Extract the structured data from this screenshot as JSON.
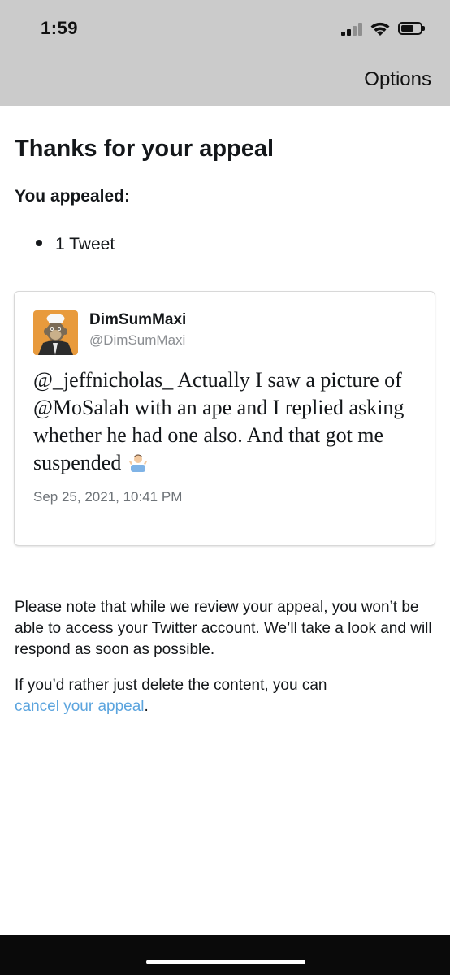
{
  "status_bar": {
    "time": "1:59"
  },
  "header": {
    "options_label": "Options"
  },
  "main": {
    "title": "Thanks for your appeal",
    "appealed_label": "You appealed:",
    "appealed_items": [
      "1 Tweet"
    ]
  },
  "tweet": {
    "display_name": "DimSumMaxi",
    "handle": "@DimSumMaxi",
    "text": "@_jeffnicholas_ Actually I saw a picture of @MoSalah with an ape and I replied asking whether he had one also. And that got me suspended",
    "emoji": "person-shrugging",
    "timestamp": "Sep 25, 2021, 10:41 PM"
  },
  "footer_notes": {
    "review_note": "Please note that while we review your appeal, you won’t be able to access your Twitter account. We’ll take a look and will respond as soon as possible.",
    "delete_prefix": "If you’d rather just delete the content, you can",
    "cancel_link": "cancel your appeal",
    "delete_suffix": "."
  },
  "colors": {
    "header_bg": "#cbcbcb",
    "link": "#5ba4de",
    "text": "#14171a",
    "muted": "#8a8d91"
  }
}
